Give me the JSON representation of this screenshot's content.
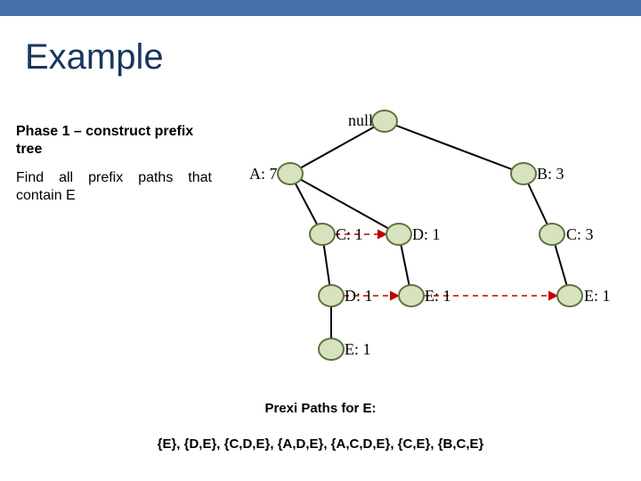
{
  "title": "Example",
  "phase": "Phase 1 – construct prefix tree",
  "finds": "Find all prefix paths that contain E",
  "tree": {
    "root": "null",
    "a7": "A: 7",
    "b3": "B: 3",
    "c1": "C: 1",
    "d1a": "D: 1",
    "c3": "C: 3",
    "d1b": "D: 1",
    "e1a": "E: 1",
    "e1b": "E: 1",
    "e1c": "E: 1"
  },
  "paths_header": "Prexi Paths for E:",
  "paths_list": "{E}, {D,E}, {C,D,E}, {A,D,E}, {A,C,D,E}, {C,E}, {B,C,E}"
}
